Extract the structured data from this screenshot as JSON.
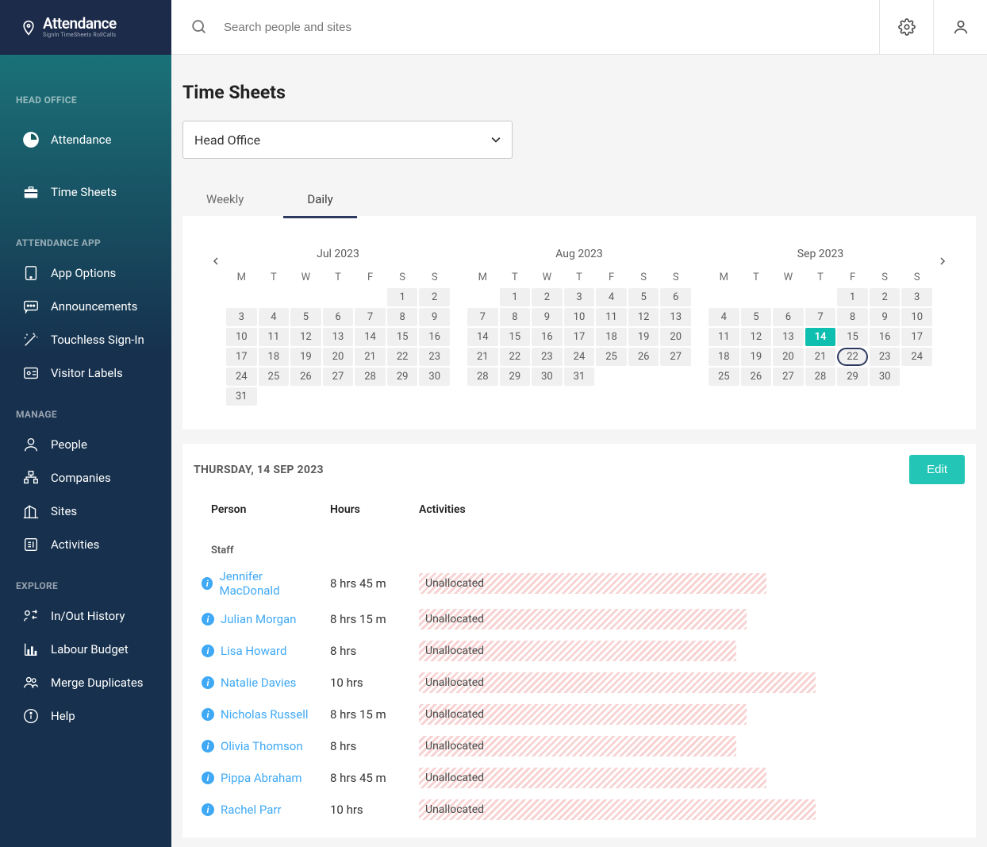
{
  "logo": {
    "title": "Attendance",
    "sub": "SignIn  TimeSheets  RollCalls"
  },
  "search": {
    "placeholder": "Search people and sites"
  },
  "sidebar": {
    "sections": [
      {
        "heading": "HEAD OFFICE",
        "items": [
          {
            "label": "Attendance",
            "icon": "clock"
          },
          {
            "label": "Time Sheets",
            "icon": "briefcase"
          }
        ]
      },
      {
        "heading": "ATTENDANCE APP",
        "items": [
          {
            "label": "App Options",
            "icon": "tablet"
          },
          {
            "label": "Announcements",
            "icon": "chat"
          },
          {
            "label": "Touchless Sign-In",
            "icon": "wand"
          },
          {
            "label": "Visitor Labels",
            "icon": "badge"
          }
        ]
      },
      {
        "heading": "MANAGE",
        "items": [
          {
            "label": "People",
            "icon": "person"
          },
          {
            "label": "Companies",
            "icon": "org"
          },
          {
            "label": "Sites",
            "icon": "building"
          },
          {
            "label": "Activities",
            "icon": "list"
          }
        ]
      },
      {
        "heading": "EXPLORE",
        "items": [
          {
            "label": "In/Out History",
            "icon": "swap"
          },
          {
            "label": "Labour Budget",
            "icon": "chart"
          },
          {
            "label": "Merge Duplicates",
            "icon": "people2"
          },
          {
            "label": "Help",
            "icon": "info"
          }
        ]
      }
    ]
  },
  "page": {
    "title": "Time Sheets"
  },
  "siteSelect": {
    "value": "Head Office"
  },
  "tabs": [
    {
      "label": "Weekly",
      "active": false
    },
    {
      "label": "Daily",
      "active": true
    }
  ],
  "calendar": {
    "dow": [
      "M",
      "T",
      "W",
      "T",
      "F",
      "S",
      "S"
    ],
    "months": [
      {
        "title": "Jul 2023",
        "startOffset": 5,
        "days": 31
      },
      {
        "title": "Aug 2023",
        "startOffset": 1,
        "days": 31
      },
      {
        "title": "Sep 2023",
        "startOffset": 4,
        "days": 30,
        "selected": 14,
        "today": 22
      }
    ]
  },
  "detail": {
    "date": "THURSDAY, 14 SEP 2023",
    "editLabel": "Edit",
    "columns": [
      "Person",
      "Hours",
      "Activities"
    ],
    "groupLabel": "Staff",
    "rows": [
      {
        "name": "Jennifer MacDonald",
        "hours": "8 hrs 45 m",
        "activity": "Unallocated",
        "minutes": 525
      },
      {
        "name": "Julian Morgan",
        "hours": "8 hrs 15 m",
        "activity": "Unallocated",
        "minutes": 495
      },
      {
        "name": "Lisa Howard",
        "hours": "8 hrs",
        "activity": "Unallocated",
        "minutes": 480
      },
      {
        "name": "Natalie Davies",
        "hours": "10 hrs",
        "activity": "Unallocated",
        "minutes": 600
      },
      {
        "name": "Nicholas Russell",
        "hours": "8 hrs 15 m",
        "activity": "Unallocated",
        "minutes": 495
      },
      {
        "name": "Olivia Thomson",
        "hours": "8 hrs",
        "activity": "Unallocated",
        "minutes": 480
      },
      {
        "name": "Pippa Abraham",
        "hours": "8 hrs 45 m",
        "activity": "Unallocated",
        "minutes": 525
      },
      {
        "name": "Rachel Parr",
        "hours": "10 hrs",
        "activity": "Unallocated",
        "minutes": 600
      }
    ],
    "maxMinutes": 600
  }
}
